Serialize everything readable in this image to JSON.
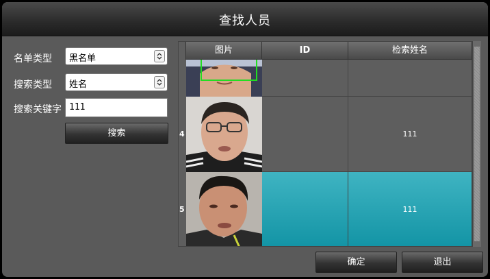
{
  "title": "查找人员",
  "form": {
    "list_type_label": "名单类型",
    "list_type_value": "黑名单",
    "search_type_label": "搜索类型",
    "search_type_value": "姓名",
    "keyword_label": "搜索关键字",
    "keyword_value": "111",
    "search_button": "搜索"
  },
  "table": {
    "columns": [
      "图片",
      "ID",
      "检索姓名"
    ],
    "rows": [
      {
        "index": "",
        "id": "",
        "name": ""
      },
      {
        "index": "4",
        "id": "",
        "name": "111"
      },
      {
        "index": "5",
        "id": "",
        "name": "111"
      }
    ]
  },
  "footer": {
    "confirm": "确定",
    "exit": "退出"
  },
  "colors": {
    "selected_row": "#1aa3b4",
    "dialog_bg": "#5a5a5a",
    "detect_box": "#22dd22"
  },
  "icons": [
    "select-arrow-icon",
    "face-photo",
    "detection-box"
  ]
}
